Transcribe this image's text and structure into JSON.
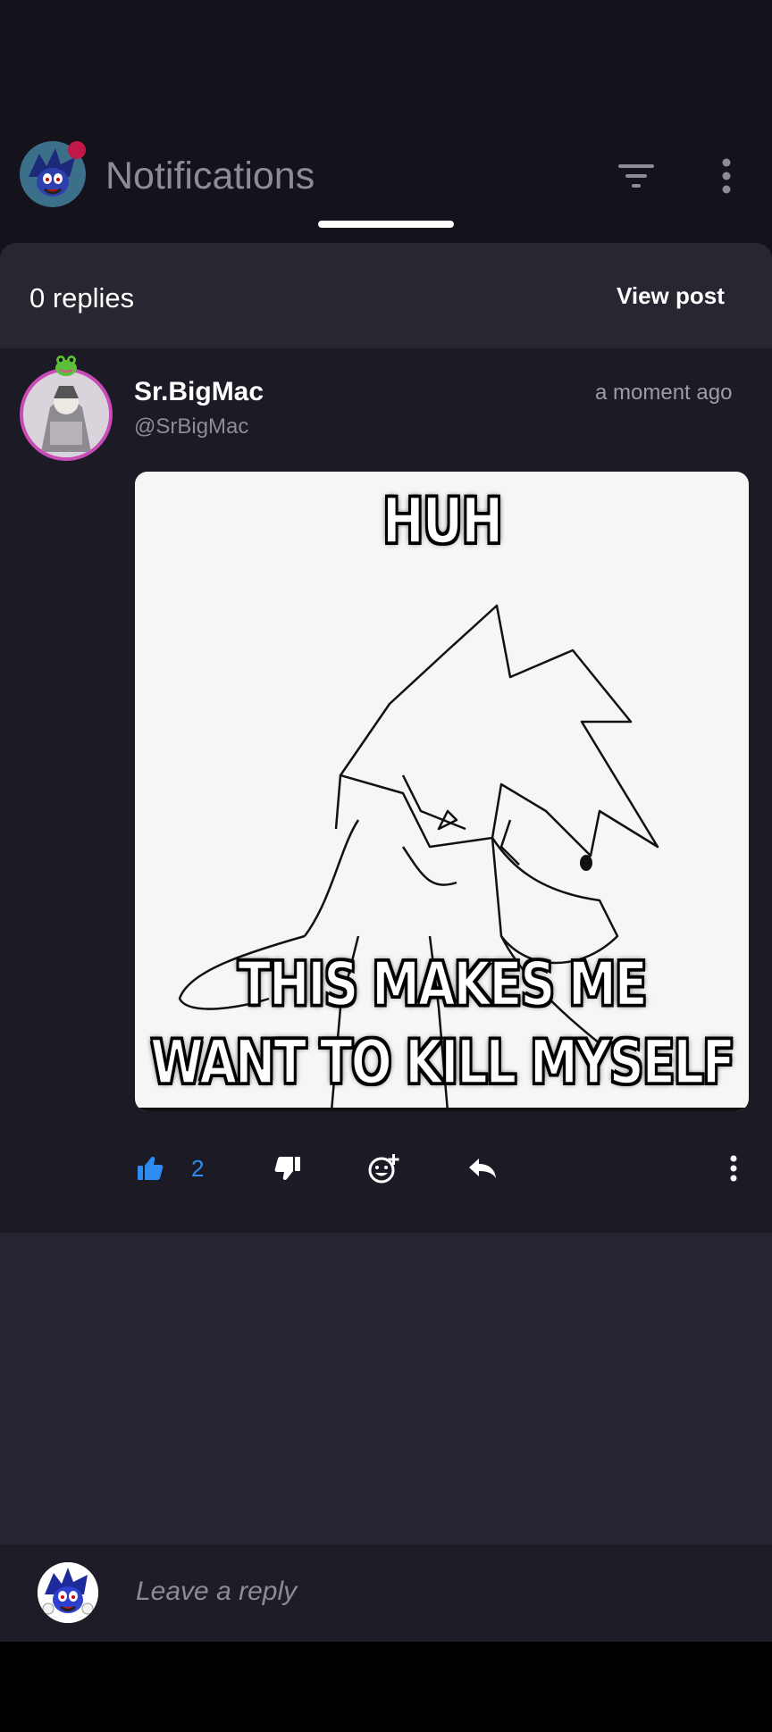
{
  "header": {
    "title": "Notifications",
    "filter_icon": "filter-icon",
    "more_icon": "more-vertical-icon"
  },
  "replies_bar": {
    "count_label": "0 replies",
    "view_post_label": "View post"
  },
  "post": {
    "author_name": "Sr.BigMac",
    "author_handle": "@SrBigMac",
    "time": "a moment ago",
    "image": {
      "top_text": "HUH",
      "bottom_text_line1": "THIS MAKES ME",
      "bottom_text_line2": "WANT TO KILL MYSELF"
    },
    "actions": {
      "like_icon": "thumbs-up-icon",
      "like_count": "2",
      "dislike_icon": "thumbs-down-icon",
      "react_icon": "add-reaction-icon",
      "reply_icon": "reply-icon",
      "more_icon": "more-vertical-icon"
    }
  },
  "reply_box": {
    "placeholder": "Leave a reply"
  },
  "colors": {
    "accent_blue": "#2e8cf0",
    "avatar_ring": "#c94cb6",
    "background": "#14131b"
  }
}
